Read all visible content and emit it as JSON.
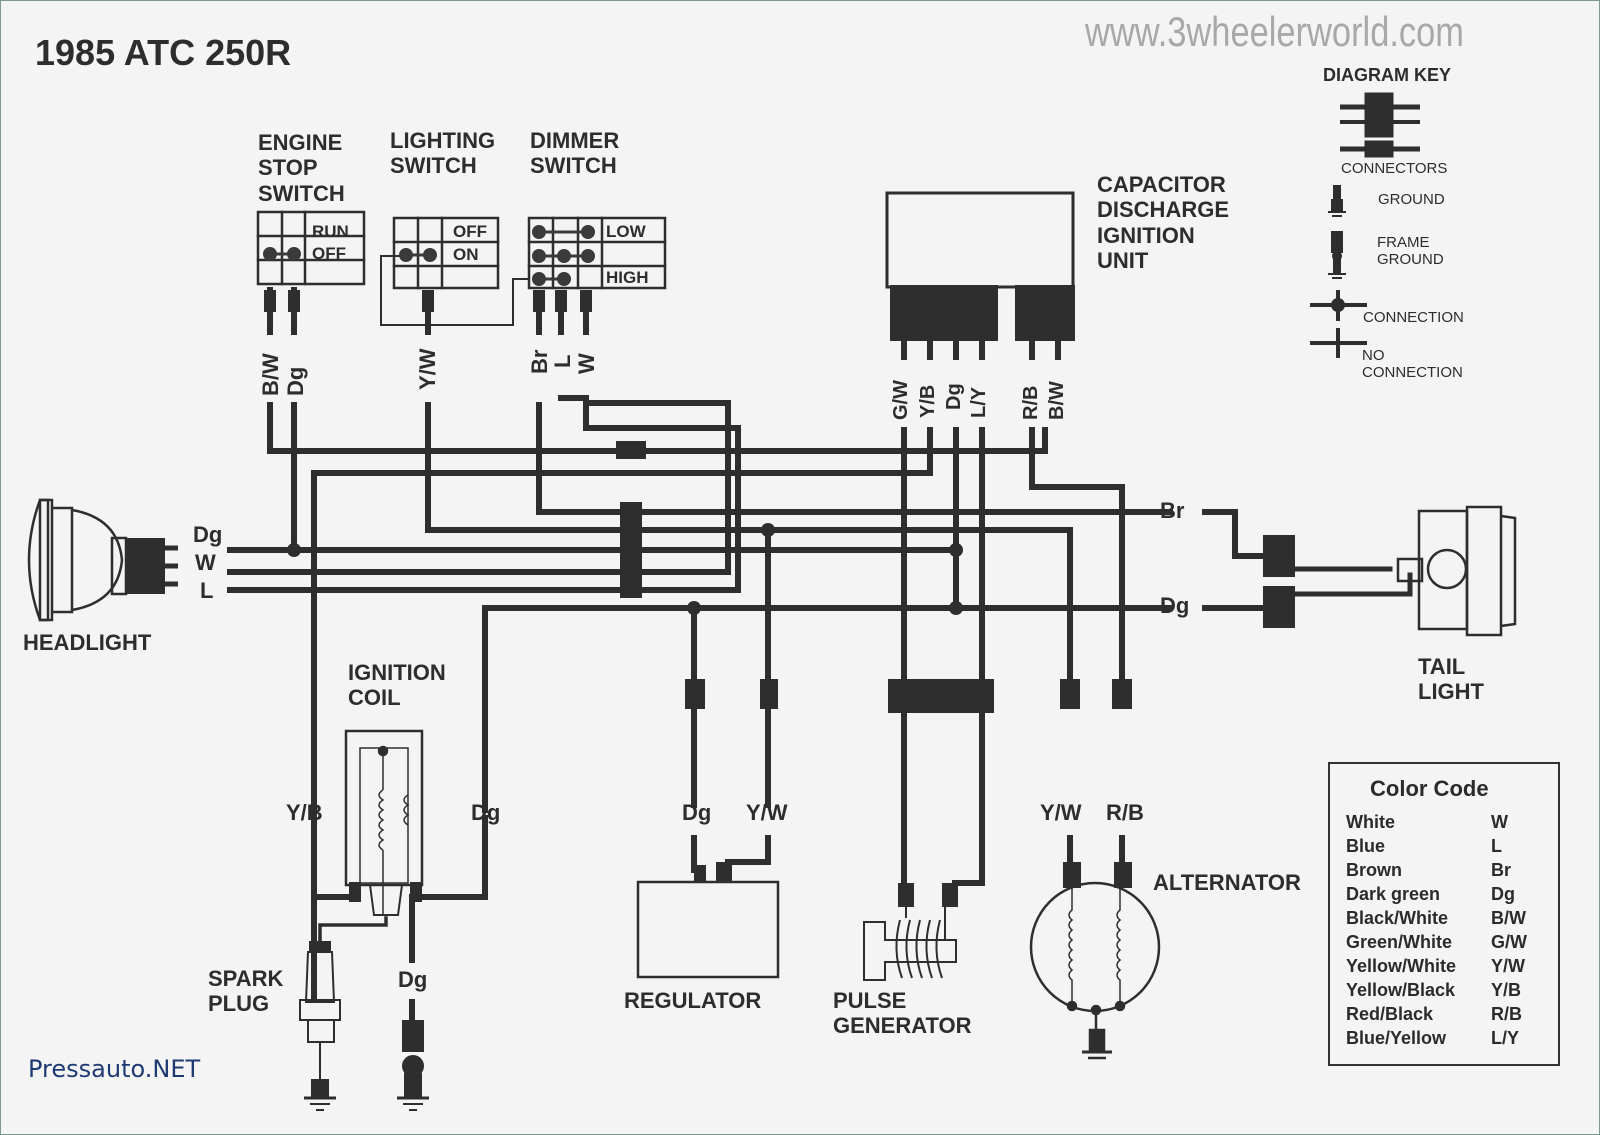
{
  "title": "1985 ATC 250R",
  "watermark": "www.3wheelerworld.com",
  "footer_credit": "Pressauto.NET",
  "components": {
    "engine_stop_switch": {
      "label": "ENGINE\nSTOP\nSWITCH",
      "positions": [
        "RUN",
        "OFF"
      ],
      "wires": [
        "B/W",
        "Dg"
      ]
    },
    "lighting_switch": {
      "label": "LIGHTING\nSWITCH",
      "positions": [
        "OFF",
        "ON"
      ],
      "wires": [
        "Y/W"
      ]
    },
    "dimmer_switch": {
      "label": "DIMMER\nSWITCH",
      "positions": [
        "LOW",
        "",
        "HIGH"
      ],
      "wires": [
        "Br",
        "L",
        "W"
      ]
    },
    "cdi_unit": {
      "label": "CAPACITOR\nDISCHARGE\nIGNITION\nUNIT",
      "wires": [
        "G/W",
        "Y/B",
        "Dg",
        "L/Y",
        "R/B",
        "B/W"
      ]
    },
    "headlight": {
      "label": "HEADLIGHT",
      "wires": [
        "Dg",
        "W",
        "L"
      ]
    },
    "tail_light": {
      "label": "TAIL\nLIGHT",
      "wires": [
        "Br",
        "Dg"
      ]
    },
    "ignition_coil": {
      "label": "IGNITION\nCOIL",
      "wires": [
        "Y/B",
        "Dg"
      ]
    },
    "spark_plug": {
      "label": "SPARK\nPLUG"
    },
    "ground_wire": {
      "wire": "Dg"
    },
    "regulator": {
      "label": "REGULATOR",
      "wires": [
        "Dg",
        "Y/W"
      ]
    },
    "pulse_generator": {
      "label": "PULSE\nGENERATOR"
    },
    "alternator": {
      "label": "ALTERNATOR",
      "wires": [
        "Y/W",
        "R/B"
      ]
    }
  },
  "diagram_key": {
    "title": "DIAGRAM KEY",
    "items": [
      "CONNECTORS",
      "GROUND",
      "FRAME\nGROUND",
      "CONNECTION",
      "NO\nCONNECTION"
    ]
  },
  "color_code": {
    "title": "Color Code",
    "rows": [
      {
        "name": "White",
        "abbr": "W"
      },
      {
        "name": "Blue",
        "abbr": "L"
      },
      {
        "name": "Brown",
        "abbr": "Br"
      },
      {
        "name": "Dark green",
        "abbr": "Dg"
      },
      {
        "name": "Black/White",
        "abbr": "B/W"
      },
      {
        "name": "Green/White",
        "abbr": "G/W"
      },
      {
        "name": "Yellow/White",
        "abbr": "Y/W"
      },
      {
        "name": "Yellow/Black",
        "abbr": "Y/B"
      },
      {
        "name": "Red/Black",
        "abbr": "R/B"
      },
      {
        "name": "Blue/Yellow",
        "abbr": "L/Y"
      }
    ]
  }
}
